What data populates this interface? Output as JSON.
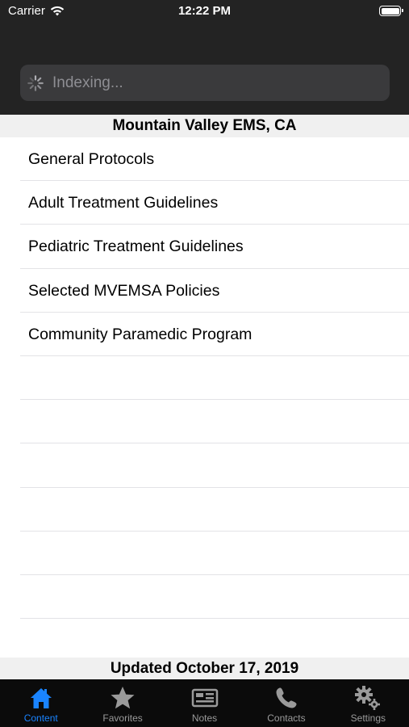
{
  "status_bar": {
    "carrier": "Carrier",
    "time": "12:22 PM"
  },
  "search": {
    "placeholder": "Indexing..."
  },
  "section_header": "Mountain Valley EMS, CA",
  "list": {
    "items": [
      {
        "label": "General Protocols"
      },
      {
        "label": "Adult Treatment Guidelines"
      },
      {
        "label": "Pediatric Treatment Guidelines"
      },
      {
        "label": "Selected MVEMSA Policies"
      },
      {
        "label": "Community Paramedic Program"
      }
    ]
  },
  "footer": "Updated October 17, 2019",
  "tabbar": {
    "tabs": [
      {
        "label": "Content",
        "icon": "house-icon",
        "active": true
      },
      {
        "label": "Favorites",
        "icon": "star-icon",
        "active": false
      },
      {
        "label": "Notes",
        "icon": "notes-icon",
        "active": false
      },
      {
        "label": "Contacts",
        "icon": "phone-icon",
        "active": false
      },
      {
        "label": "Settings",
        "icon": "gear-icon",
        "active": false
      }
    ]
  },
  "colors": {
    "header_bg": "#232323",
    "accent": "#1a84ff",
    "tab_inactive": "#9a9a9a"
  }
}
